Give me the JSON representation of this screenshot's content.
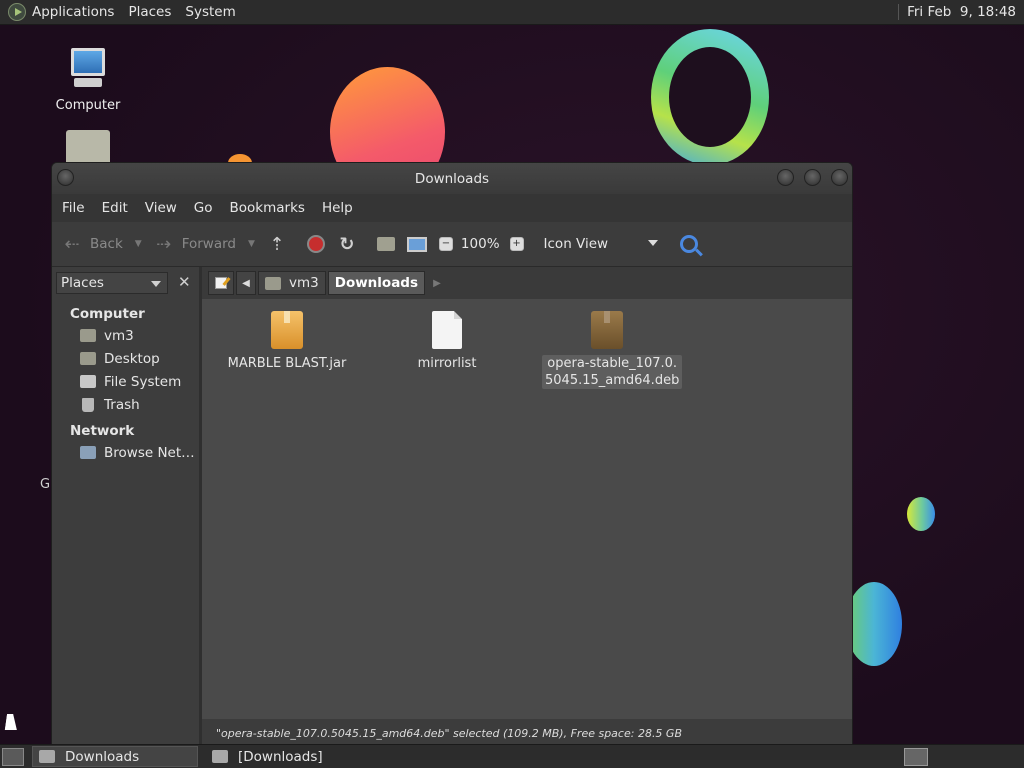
{
  "top_panel": {
    "menus": [
      "Applications",
      "Places",
      "System"
    ],
    "clock": "Fri Feb  9, 18:48"
  },
  "desktop": {
    "icons": [
      {
        "label": "Computer",
        "icon": "computer-icon"
      },
      {
        "label": "",
        "icon": "home-folder-icon"
      }
    ],
    "partial_label": "G"
  },
  "window": {
    "title": "Downloads",
    "menubar": [
      "File",
      "Edit",
      "View",
      "Go",
      "Bookmarks",
      "Help"
    ],
    "toolbar": {
      "back_label": "Back",
      "forward_label": "Forward",
      "zoom_level": "100%",
      "view_mode": "Icon View"
    },
    "sidebar": {
      "selector_label": "Places",
      "sections": [
        {
          "title": "Computer",
          "items": [
            {
              "label": "vm3",
              "icon": "home-folder-icon"
            },
            {
              "label": "Desktop",
              "icon": "desktop-folder-icon"
            },
            {
              "label": "File System",
              "icon": "drive-icon"
            },
            {
              "label": "Trash",
              "icon": "trash-icon"
            }
          ]
        },
        {
          "title": "Network",
          "items": [
            {
              "label": "Browse Net…",
              "icon": "network-icon"
            }
          ]
        }
      ]
    },
    "pathbar": {
      "segments": [
        "vm3",
        "Downloads"
      ],
      "active": "Downloads"
    },
    "files": [
      {
        "name": "MARBLE BLAST.jar",
        "icon": "package-icon",
        "selected": false
      },
      {
        "name": "mirrorlist",
        "icon": "text-file-icon",
        "selected": false
      },
      {
        "name_line1": "opera-stable_107.0.",
        "name_line2": "5045.15_amd64.deb",
        "icon": "debian-package-icon",
        "selected": true
      }
    ],
    "status": "\"opera-stable_107.0.5045.15_amd64.deb\" selected (109.2 MB), Free space: 28.5 GB"
  },
  "bottom_panel": {
    "tasks": [
      {
        "label": "Downloads",
        "active": true
      },
      {
        "label": "[Downloads]",
        "active": false
      }
    ]
  }
}
